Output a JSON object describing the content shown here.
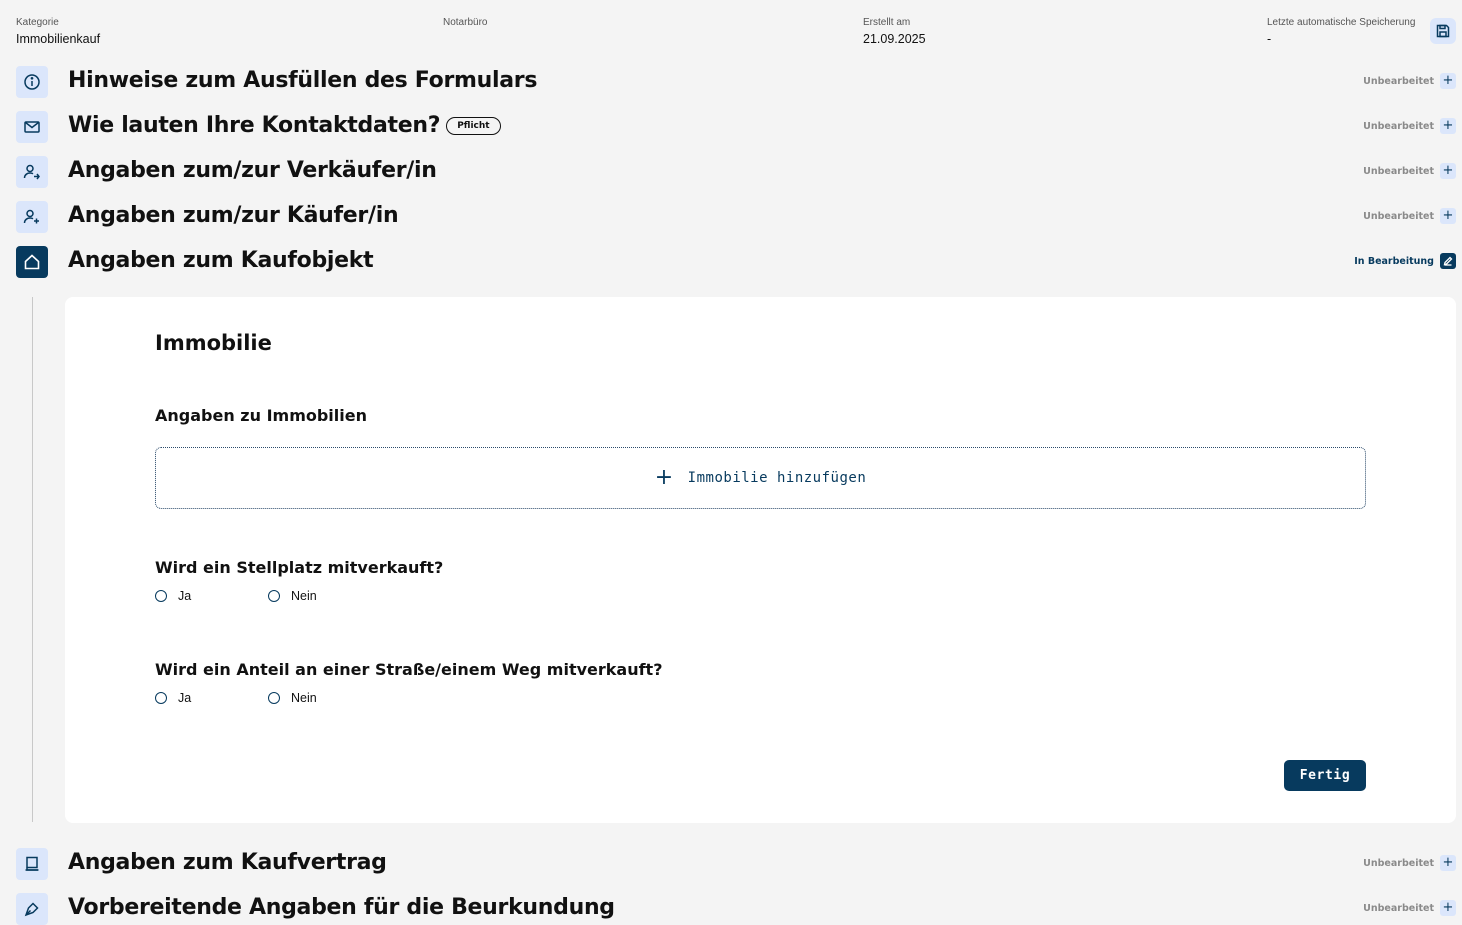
{
  "header": {
    "kategorie_label": "Kategorie",
    "kategorie_value": "Immobilienkauf",
    "notarbuero_label": "Notarbüro",
    "erstellt_label": "Erstellt am",
    "erstellt_value": "21.09.2025",
    "speicherung_label": "Letzte automatische Speicherung",
    "speicherung_value": "-",
    "save_icon": "floppy-disk-icon"
  },
  "sections": [
    {
      "title": "Hinweise zum Ausfüllen des Formulars",
      "status": "Unbearbeitet",
      "icon": "info-icon"
    },
    {
      "title": "Wie lauten Ihre Kontaktdaten?",
      "badge": "Pflicht",
      "status": "Unbearbeitet",
      "icon": "envelope-icon"
    },
    {
      "title": "Angaben zum/zur Verkäufer/in",
      "status": "Unbearbeitet",
      "icon": "user-arrow-icon"
    },
    {
      "title": "Angaben zum/zur Käufer/in",
      "status": "Unbearbeitet",
      "icon": "user-plus-icon"
    },
    {
      "title": "Angaben zum Kaufobjekt",
      "status": "In Bearbeitung",
      "icon": "house-icon"
    },
    {
      "title": "Angaben zum Kaufvertrag",
      "status": "Unbearbeitet",
      "icon": "document-icon"
    },
    {
      "title": "Vorbereitende Angaben für die Beurkundung",
      "status": "Unbearbeitet",
      "icon": "pen-nib-icon"
    }
  ],
  "form": {
    "heading": "Immobilie",
    "subheading": "Angaben zu Immobilien",
    "add_button": "Immobilie hinzufügen",
    "q1": "Wird ein Stellplatz mitverkauft?",
    "q2": "Wird ein Anteil an einer Straße/einem Weg mitverkauft?",
    "opt_yes": "Ja",
    "opt_no": "Nein",
    "done_button": "Fertig"
  },
  "colors": {
    "primary": "#073a5e",
    "icon_bg": "#dbe6fb",
    "background": "#f4f4f4"
  }
}
